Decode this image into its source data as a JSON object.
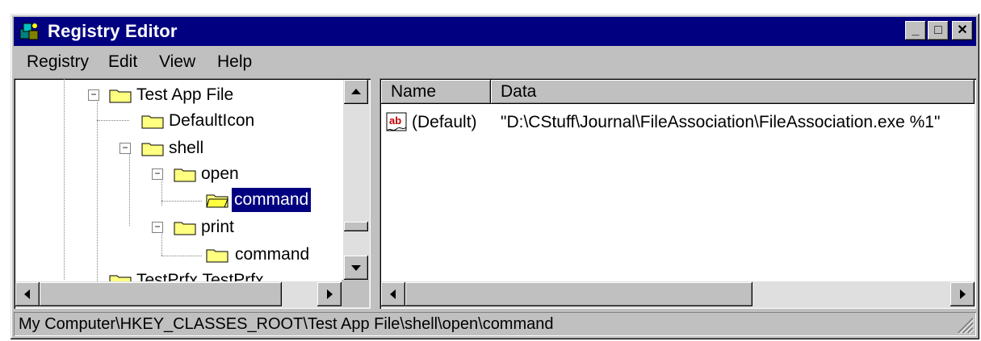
{
  "window": {
    "title": "Registry Editor",
    "buttons": {
      "minimize": "_",
      "maximize": "□",
      "close": "✕"
    }
  },
  "menu": [
    {
      "label": "Registry"
    },
    {
      "label": "Edit"
    },
    {
      "label": "View"
    },
    {
      "label": "Help"
    }
  ],
  "tree": {
    "nodes": [
      {
        "label": "Test App File",
        "expander": "−"
      },
      {
        "label": "DefaultIcon"
      },
      {
        "label": "shell",
        "expander": "−"
      },
      {
        "label": "open",
        "expander": "−"
      },
      {
        "label": "command",
        "selected": true
      },
      {
        "label": "print",
        "expander": "−"
      },
      {
        "label": "command"
      }
    ],
    "partial_label": "TestPrfx.TestPrfx"
  },
  "list": {
    "columns": [
      "Name",
      "Data"
    ],
    "rows": [
      {
        "icon": "ab",
        "name": "(Default)",
        "data": "\"D:\\CStuff\\Journal\\FileAssociation\\FileAssociation.exe %1\""
      }
    ]
  },
  "status": {
    "path": "My Computer\\HKEY_CLASSES_ROOT\\Test App File\\shell\\open\\command"
  },
  "colors": {
    "titlebar": "#000080",
    "chrome": "#c0c0c0",
    "selection": "#000080"
  }
}
